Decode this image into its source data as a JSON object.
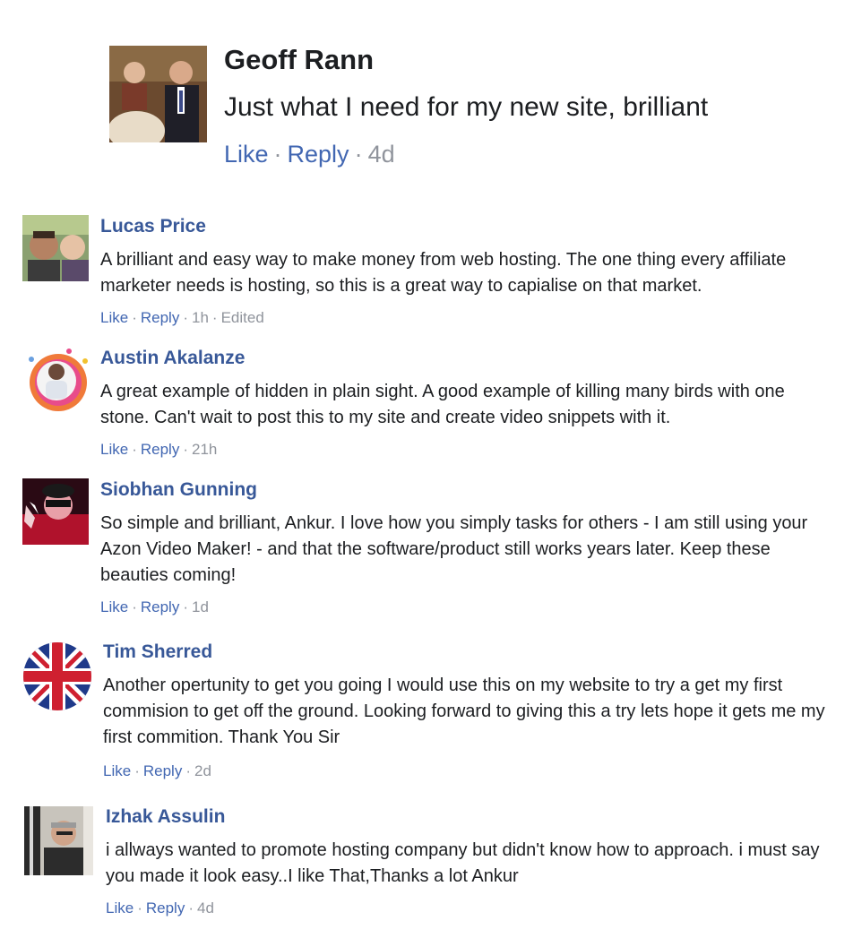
{
  "labels": {
    "like": "Like",
    "reply": "Reply",
    "sep": "·"
  },
  "comments": [
    {
      "author": "Geoff Rann",
      "text": "Just what I need for my new site, brilliant",
      "time": "4d",
      "edited": ""
    },
    {
      "author": "Lucas Price",
      "text": "A brilliant and easy way to make money from web hosting. The one thing every affiliate marketer needs is hosting, so this is a great way to capialise on that market.",
      "time": "1h",
      "edited": "Edited"
    },
    {
      "author": "Austin Akalanze",
      "text": "A great example of hidden in plain sight. A good example of killing many birds with one stone. Can't wait to post this to my site and create video snippets with it.",
      "time": "21h",
      "edited": ""
    },
    {
      "author": "Siobhan Gunning",
      "text": "So simple and brilliant, Ankur. I love how you simply tasks for others - I am still using your Azon Video Maker! - and that the software/product still works years later. Keep these beauties coming!",
      "time": "1d",
      "edited": ""
    },
    {
      "author": "Tim Sherred",
      "text": "Another opertunity to get you going I would use this on my website to try a get my first commision to get off the ground. Looking forward to giving this a try lets hope it gets me my first commition. Thank You Sir",
      "time": "2d",
      "edited": ""
    },
    {
      "author": "Izhak Assulin",
      "text": "i allways wanted to promote hosting company but didn't know how to approach. i must say you made it look easy..I like That,Thanks a lot Ankur",
      "time": "4d",
      "edited": ""
    }
  ]
}
